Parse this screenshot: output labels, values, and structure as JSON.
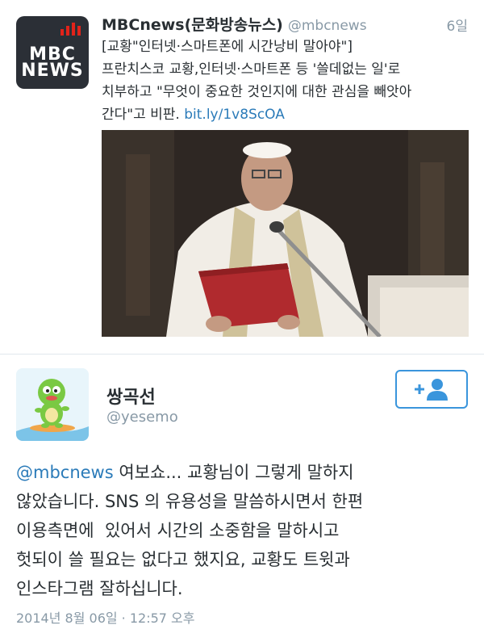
{
  "quoted_tweet": {
    "author_name": "MBCnews(문화방송뉴스)",
    "author_handle": "@mbcnews",
    "time": "6일",
    "avatar_text_line1": "MBC",
    "avatar_text_line2": "NEWS",
    "text_line1": "[교황\"인터넷·스마트폰에 시간낭비 말아야\"]",
    "text_line2": "프란치스코 교황,인터넷·스마트폰 등 '쓸데없는 일'로",
    "text_line3": "치부하고 \"무엇이 중요한 것인지에 대한 관심을 빼앗아",
    "text_line4": "간다\"고 비판.",
    "link": "bit.ly/1v8ScOA",
    "photo_icon": "photo-of-pope-at-podium"
  },
  "main_tweet": {
    "author_name": "쌍곡선",
    "author_handle": "@yesemo",
    "avatar_icon": "green-dinosaur-mascot-icon",
    "follow_icon": "add-user-icon",
    "mention": "@mbcnews",
    "text_line1_rest": " 여보쇼... 교황님이 그렇게 말하지",
    "text_line2": "않았습니다. SNS 의 유용성을 말씀하시면서 한편",
    "text_line3": "이용측면에  있어서 시간의 소중함을 말하시고",
    "text_line4": "헛되이 쓸 필요는 없다고 했지요, 교황도 트윗과",
    "text_line5": "인스타그램 잘하십니다.",
    "timestamp": "2014년 8월 06일 · 12:57 오후"
  },
  "colors": {
    "link": "#2b7bb9",
    "muted": "#8899a6",
    "follow_border": "#3a95dc",
    "text": "#292f33"
  }
}
